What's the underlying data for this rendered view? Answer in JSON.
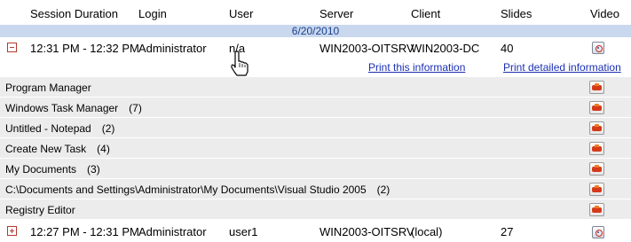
{
  "columns": {
    "session_duration": "Session Duration",
    "login": "Login",
    "user": "User",
    "server": "Server",
    "client": "Client",
    "slides": "Slides",
    "video": "Video"
  },
  "date_group": "6/20/2010",
  "sessions": [
    {
      "expander": "collapse",
      "duration": "12:31 PM - 12:32 PM",
      "login": "Administrator",
      "user": "n/a",
      "server": "WIN2003-OITSRV",
      "client": "WIN2003-DC",
      "slides": "40",
      "video_icon": "video-play-icon"
    },
    {
      "expander": "expand",
      "duration": "12:27 PM - 12:31 PM",
      "login": "Administrator",
      "user": "user1",
      "server": "WIN2003-OITSRV",
      "client": "(local)",
      "slides": "27",
      "video_icon": "video-play-icon"
    }
  ],
  "links": {
    "print_info": "Print this information",
    "print_detailed": "Print detailed information"
  },
  "applications": [
    {
      "title": "Program Manager",
      "count": ""
    },
    {
      "title": "Windows Task Manager",
      "count": "(7)"
    },
    {
      "title": "Untitled - Notepad",
      "count": "(2)"
    },
    {
      "title": "Create New Task",
      "count": "(4)"
    },
    {
      "title": "My Documents",
      "count": "(3)"
    },
    {
      "title": "C:\\Documents and Settings\\Administrator\\My Documents\\Visual Studio 2005",
      "count": "(2)"
    },
    {
      "title": "Registry Editor",
      "count": ""
    }
  ],
  "colors": {
    "date_bar": "#c9d8ee",
    "link": "#1a2fb3",
    "row_bg": "#ececec"
  }
}
